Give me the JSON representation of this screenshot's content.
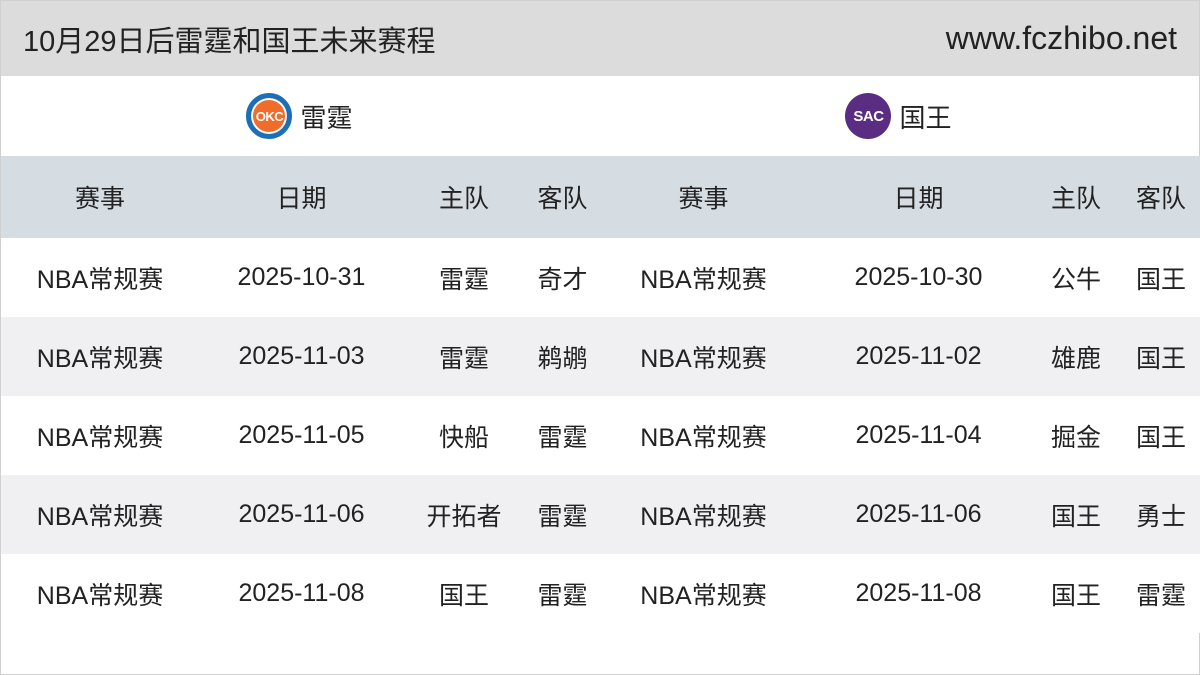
{
  "header": {
    "title": "10月29日后雷霆和国王未来赛程",
    "site": "www.fczhibo.net"
  },
  "teams": {
    "left": {
      "name": "雷霆",
      "logo_text": "OKC"
    },
    "right": {
      "name": "国王",
      "logo_text": "SAC"
    }
  },
  "table": {
    "headers": [
      "赛事",
      "日期",
      "主队",
      "客队",
      "赛事",
      "日期",
      "主队",
      "客队"
    ],
    "rows": [
      [
        "NBA常规赛",
        "2025-10-31",
        "雷霆",
        "奇才",
        "NBA常规赛",
        "2025-10-30",
        "公牛",
        "国王"
      ],
      [
        "NBA常规赛",
        "2025-11-03",
        "雷霆",
        "鹈鹕",
        "NBA常规赛",
        "2025-11-02",
        "雄鹿",
        "国王"
      ],
      [
        "NBA常规赛",
        "2025-11-05",
        "快船",
        "雷霆",
        "NBA常规赛",
        "2025-11-04",
        "掘金",
        "国王"
      ],
      [
        "NBA常规赛",
        "2025-11-06",
        "开拓者",
        "雷霆",
        "NBA常规赛",
        "2025-11-06",
        "国王",
        "勇士"
      ],
      [
        "NBA常规赛",
        "2025-11-08",
        "国王",
        "雷霆",
        "NBA常规赛",
        "2025-11-08",
        "国王",
        "雷霆"
      ]
    ]
  }
}
